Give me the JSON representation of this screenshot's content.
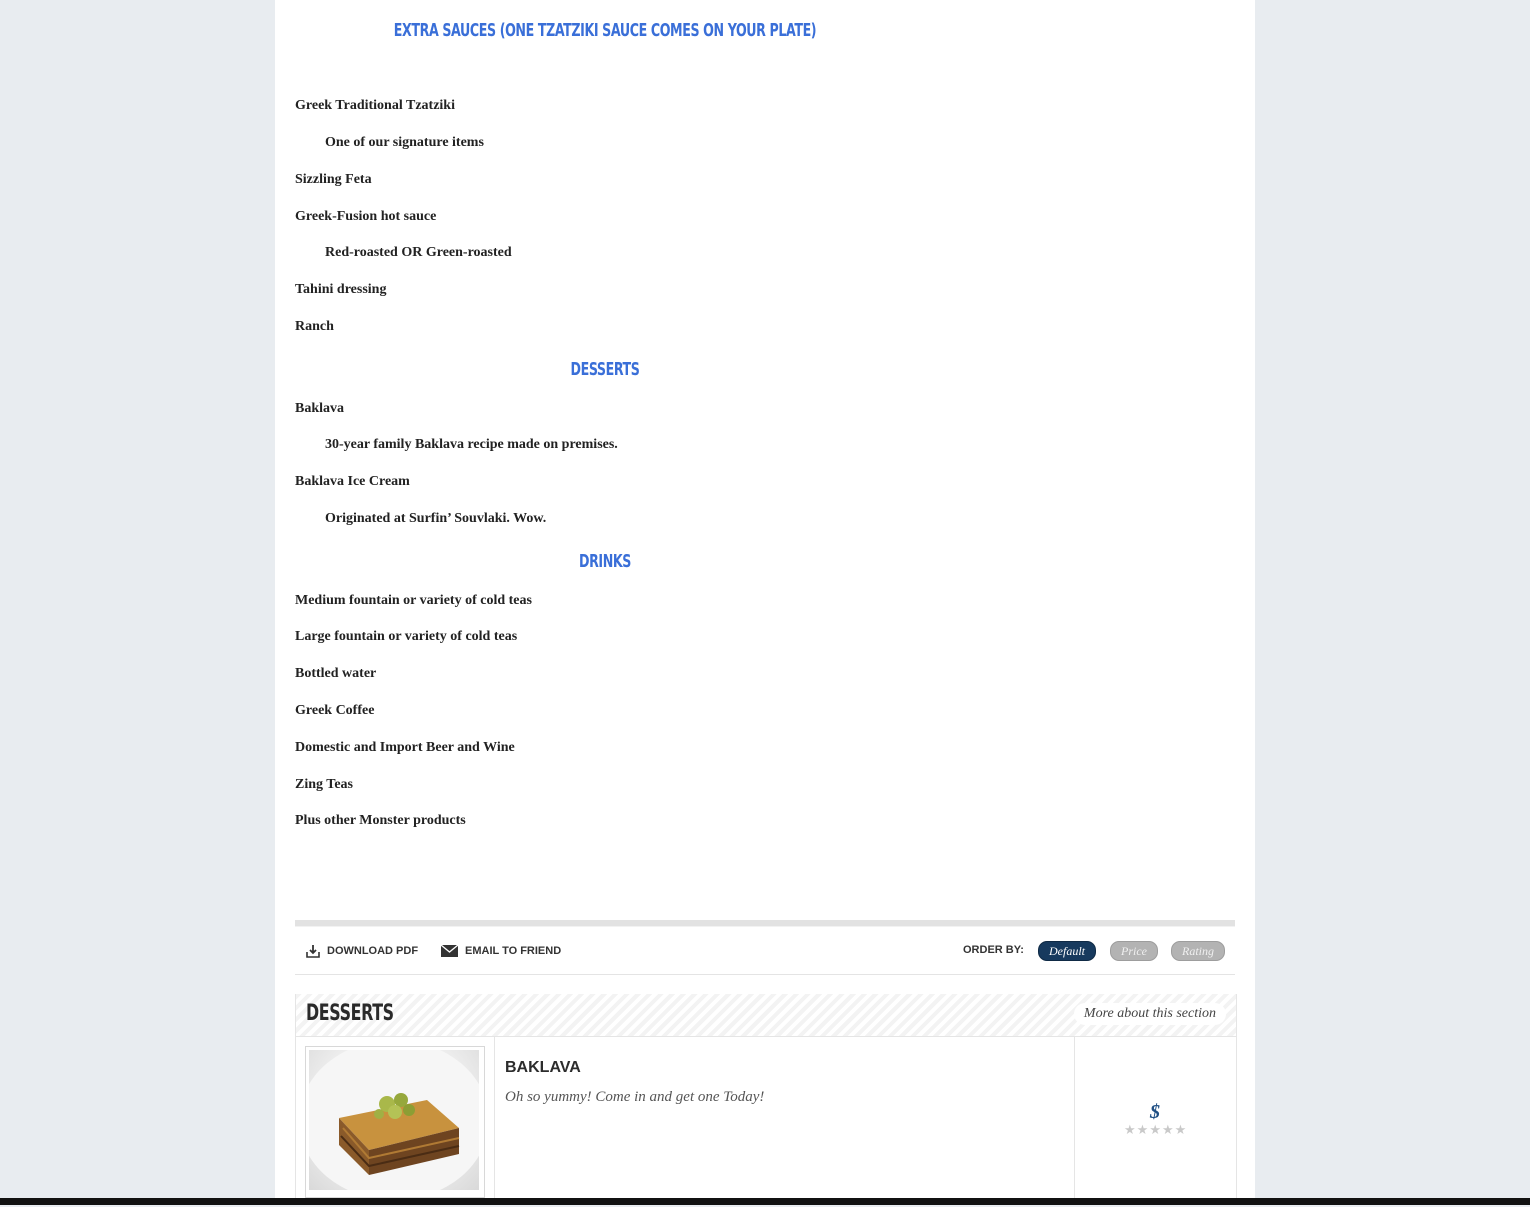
{
  "menu": {
    "sections": [
      {
        "heading": "EXTRA SAUCES (ONE TZATZIKI SAUCE COMES ON YOUR PLATE)",
        "items": [
          {
            "text": "Greek Traditional Tzatziki",
            "sub": false
          },
          {
            "text": "One of our signature items",
            "sub": true
          },
          {
            "text": "Sizzling Feta",
            "sub": false
          },
          {
            "text": "Greek-Fusion hot sauce",
            "sub": false
          },
          {
            "text": "Red-roasted OR Green-roasted",
            "sub": true
          },
          {
            "text": "Tahini dressing",
            "sub": false
          },
          {
            "text": "Ranch",
            "sub": false
          }
        ]
      },
      {
        "heading": "DESSERTS",
        "items": [
          {
            "text": "Baklava",
            "sub": false
          },
          {
            "text": "30-year family Baklava recipe made on premises.",
            "sub": true
          },
          {
            "text": "Baklava Ice Cream",
            "sub": false
          },
          {
            "text": "Originated at Surfin’ Souvlaki. Wow.",
            "sub": true
          }
        ]
      },
      {
        "heading": "DRINKS",
        "items": [
          {
            "text": "Medium fountain or variety of cold teas",
            "sub": false
          },
          {
            "text": "Large fountain or variety of cold teas",
            "sub": false
          },
          {
            "text": "Bottled water",
            "sub": false
          },
          {
            "text": "Greek Coffee",
            "sub": false
          },
          {
            "text": "Domestic and Import Beer and Wine",
            "sub": false
          },
          {
            "text": "Zing Teas",
            "sub": false
          },
          {
            "text": "Plus other Monster products",
            "sub": false
          }
        ]
      }
    ]
  },
  "toolbar": {
    "download_pdf": "DOWNLOAD PDF",
    "email_friend": "EMAIL TO FRIEND",
    "order_by_label": "ORDER BY:",
    "order_options": [
      {
        "label": "Default",
        "active": true
      },
      {
        "label": "Price",
        "active": false
      },
      {
        "label": "Rating",
        "active": false
      }
    ]
  },
  "section": {
    "title": "DESSERTS",
    "more_link": "More about this section",
    "item": {
      "name": "BAKLAVA",
      "description": "Oh so yummy! Come in and get one Today!",
      "price": "$",
      "rating": 0,
      "rating_max": 5
    }
  },
  "colors": {
    "heading_blue": "#3a6fd8",
    "active_pill": "#173a5e",
    "price_blue": "#1f4f84"
  }
}
